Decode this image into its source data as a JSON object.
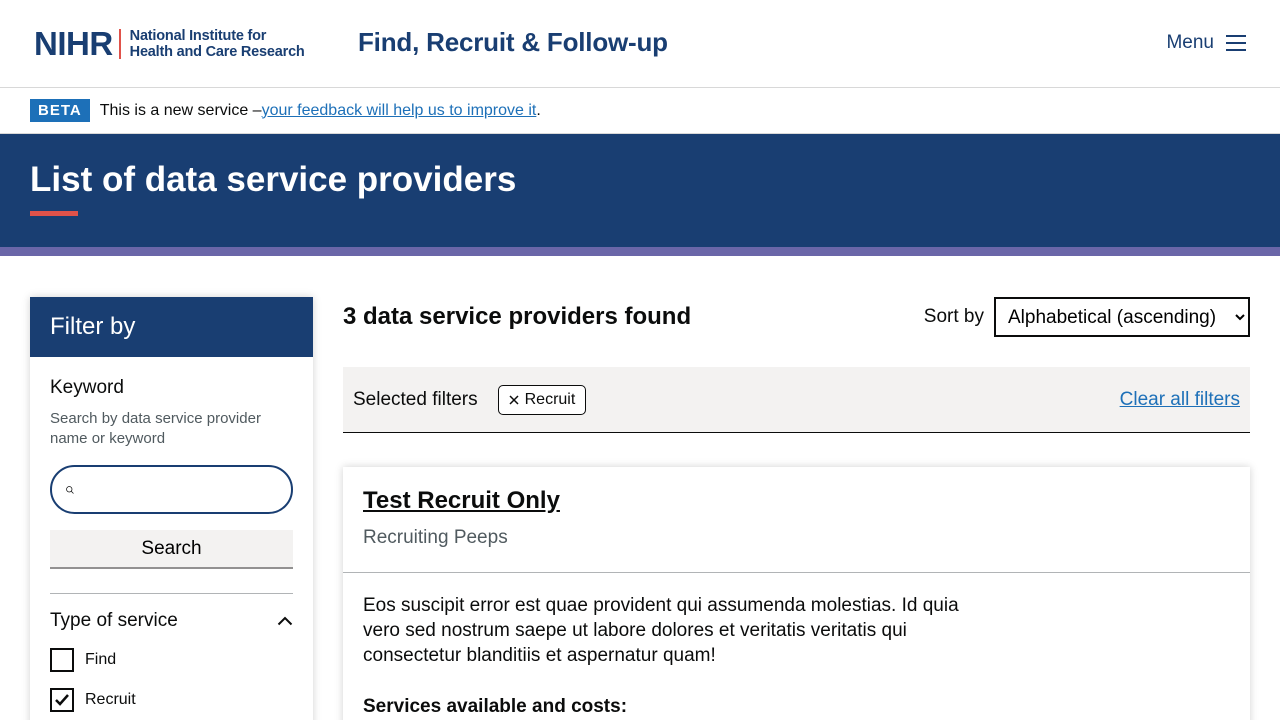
{
  "header": {
    "logo_mark": "NIHR",
    "logo_line1": "National Institute for",
    "logo_line2": "Health and Care Research",
    "service_name": "Find, Recruit & Follow-up",
    "menu_label": "Menu"
  },
  "beta": {
    "tag": "BETA",
    "text": "This is a new service – ",
    "link": "your feedback will help us to improve it",
    "suffix": "."
  },
  "hero": {
    "title": "List of data service providers"
  },
  "filter": {
    "title": "Filter by",
    "keyword_label": "Keyword",
    "keyword_hint": "Search by data service provider name or keyword",
    "search_value": "",
    "search_button": "Search",
    "type_of_service": "Type of service",
    "options": [
      {
        "label": "Find",
        "checked": false
      },
      {
        "label": "Recruit",
        "checked": true
      }
    ]
  },
  "results": {
    "count_text": "3 data service providers found",
    "sort_label": "Sort by",
    "sort_value": "Alphabetical (ascending)",
    "selected_filters_label": "Selected filters",
    "chip": "Recruit",
    "clear_all": "Clear all filters"
  },
  "card": {
    "title": "Test Recruit Only",
    "subtitle": "Recruiting Peeps",
    "description": "Eos suscipit error est quae provident qui assumenda molestias. Id quia vero sed nostrum saepe ut labore dolores et veritatis veritatis qui consectetur blanditiis et aspernatur quam!",
    "services_heading": "Services available and costs:"
  },
  "colors": {
    "brand_navy": "#193e72",
    "accent_red": "#e0524a",
    "stripe_purple": "#6a66a8",
    "link_blue": "#1d70b8"
  }
}
